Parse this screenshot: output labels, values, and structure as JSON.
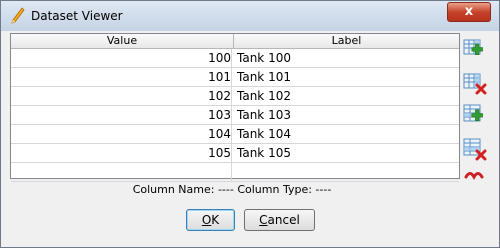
{
  "window": {
    "title": "Dataset Viewer",
    "close_label": "x"
  },
  "table": {
    "columns": [
      {
        "label": "Value"
      },
      {
        "label": "Label"
      }
    ],
    "rows": [
      {
        "value": "100",
        "label": "Tank 100"
      },
      {
        "value": "101",
        "label": "Tank 101"
      },
      {
        "value": "102",
        "label": "Tank 102"
      },
      {
        "value": "103",
        "label": "Tank 103"
      },
      {
        "value": "104",
        "label": "Tank 104"
      },
      {
        "value": "105",
        "label": "Tank 105"
      }
    ]
  },
  "side_toolbar": {
    "icons": [
      "add-column-icon",
      "remove-column-icon",
      "add-row-icon",
      "remove-row-icon",
      "collapse-icon"
    ]
  },
  "column_info": {
    "text": "Column Name: ----   Column Type: ----"
  },
  "buttons": {
    "ok_mnemonic": "O",
    "ok_rest": "K",
    "cancel_mnemonic": "C",
    "cancel_rest": "ancel"
  },
  "colors": {
    "title_top": "#dfe8f3",
    "title_bottom": "#c5d3e4",
    "close": "#c7432c",
    "add": "#2f9e2f",
    "remove": "#d42020"
  }
}
